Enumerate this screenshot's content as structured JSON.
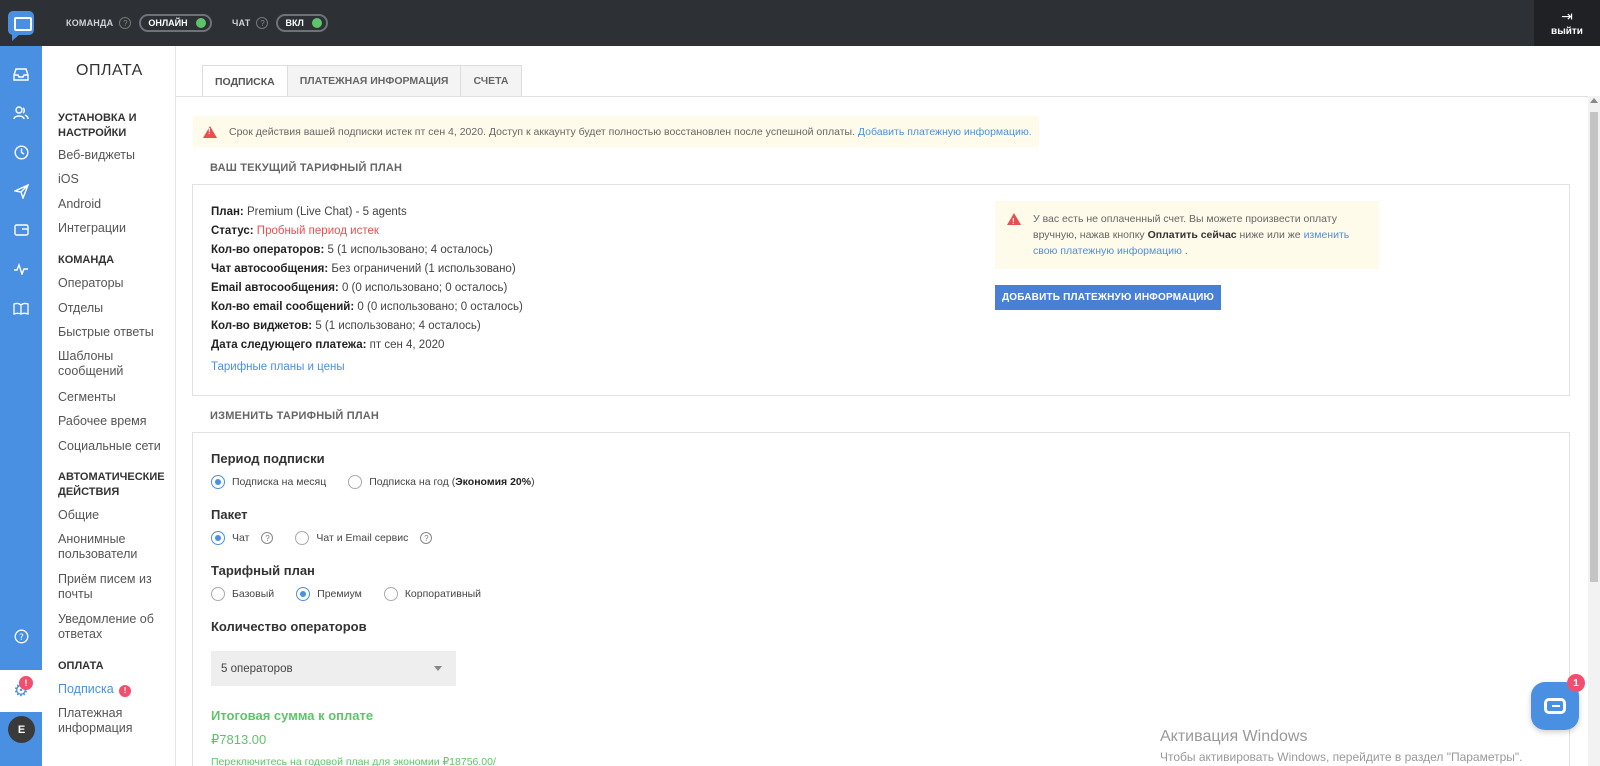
{
  "topbar": {
    "team_label": "КОМАНДА",
    "team_status": "ОНЛАЙН",
    "chat_label": "ЧАТ",
    "chat_status": "ВКЛ",
    "logout_label": "выйти",
    "accent_color": "#5ec46a"
  },
  "rail": {
    "icons": [
      "inbox-icon",
      "users-icon",
      "clock-icon",
      "send-icon",
      "widget-icon",
      "activity-icon",
      "book-icon",
      "help-icon",
      "settings-icon"
    ],
    "settings_badge": "!",
    "avatar_initial": "E",
    "color": "#4a90e2"
  },
  "sidebar": {
    "title": "ОПЛАТА",
    "sections": [
      {
        "title": "УСТАНОВКА И НАСТРОЙКИ",
        "items": [
          "Веб-виджеты",
          "iOS",
          "Android",
          "Интеграции"
        ]
      },
      {
        "title": "КОМАНДА",
        "items": [
          "Операторы",
          "Отделы",
          "Быстрые ответы",
          "Шаблоны сообщений",
          "Сегменты",
          "Рабочее время",
          "Социальные сети"
        ]
      },
      {
        "title": "АВТОМАТИЧЕСКИЕ ДЕЙСТВИЯ",
        "items": [
          "Общие",
          "Анонимные пользователи",
          "Приём писем из почты",
          "Уведомление об ответах"
        ]
      },
      {
        "title": "ОПЛАТА",
        "items": [
          "Подписка",
          "Платежная информация"
        ]
      }
    ],
    "active_badge": "!"
  },
  "tabs": [
    "ПОДПИСКА",
    "ПЛАТЕЖНАЯ ИНФОРМАЦИЯ",
    "СЧЕТА"
  ],
  "alert_top": {
    "text": "Срок действия вашей подписки истек пт сен 4, 2020. Доступ к аккаунту будет полностью восстановлен после успешной оплаты.",
    "link": "Добавить платежную информацию."
  },
  "current_plan": {
    "heading": "ВАШ ТЕКУЩИЙ ТАРИФНЫЙ ПЛАН",
    "lines": [
      {
        "label": "План:",
        "value": "Premium (Live Chat) - 5 agents"
      },
      {
        "label": "Статус:",
        "value": "Пробный период истек"
      },
      {
        "label": "Кол-во операторов:",
        "value": "5 (1 использовано; 4 осталось)"
      },
      {
        "label": "Чат автосообщения:",
        "value": "Без ограничений (1 использовано)"
      },
      {
        "label": "Email автосообщения:",
        "value": "0 (0 использовано; 0 осталось)"
      },
      {
        "label": "Кол-во email сообщений:",
        "value": "0 (0 использовано; 0 осталось)"
      },
      {
        "label": "Кол-во виджетов:",
        "value": "5 (1 использовано; 4 осталось)"
      },
      {
        "label": "Дата следующего платежа:",
        "value": "пт сен 4, 2020"
      }
    ],
    "status_color": "#e85050",
    "plans_link": "Тарифные планы и цены",
    "invoice_alert": {
      "text1": "У вас есть не оплаченный счет. Вы можете произвести оплату вручную, нажав кнопку",
      "bold": "Оплатить сейчас",
      "text2": "ниже или же",
      "link": "изменить свою платежную информацию",
      "end": "."
    },
    "add_payment_button": "ДОБАВИТЬ ПЛАТЕЖНУЮ ИНФОРМАЦИЮ"
  },
  "change_plan": {
    "heading": "ИЗМЕНИТЬ ТАРИФНЫЙ ПЛАН",
    "period": {
      "title": "Период подписки",
      "options": [
        "Подписка на месяц",
        "Подписка на год ("
      ],
      "bold_suffix": "Экономия 20%",
      "close": ")",
      "selected": 0
    },
    "package": {
      "title": "Пакет",
      "options": [
        "Чат",
        "Чат и Email сервис"
      ],
      "selected": 0
    },
    "tariff": {
      "title": "Тарифный план",
      "options": [
        "Базовый",
        "Премиум",
        "Корпоративный"
      ],
      "selected": 1
    },
    "operators": {
      "title": "Количество операторов",
      "value": "5 операторов"
    },
    "total_title": "Итоговая сумма к оплате",
    "total_value": "₽7813.00",
    "total_note": "Переключитесь на годовой план для экономии ₽18756.00/",
    "total_color": "#5ec46a"
  },
  "chat_widget": {
    "badge": "1"
  },
  "watermark": {
    "line1": "Активация Windows",
    "line2": "Чтобы активировать Windows, перейдите в раздел \"Параметры\"."
  }
}
